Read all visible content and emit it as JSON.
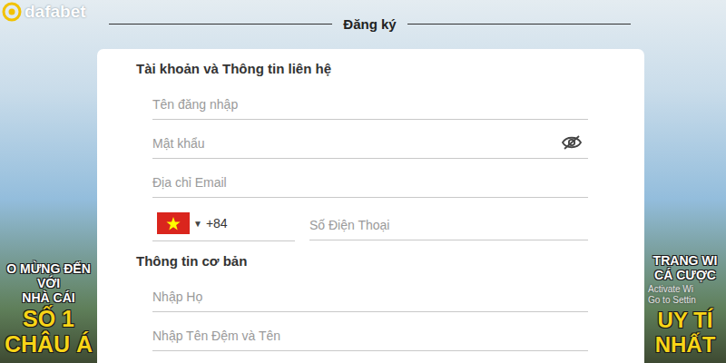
{
  "brand": {
    "name": "dafabet"
  },
  "header": {
    "title": "Đăng ký"
  },
  "form": {
    "sections": [
      {
        "title": "Tài khoản và Thông tin liên hệ",
        "fields": [
          {
            "kind": "text",
            "placeholder": "Tên đăng nhập"
          },
          {
            "kind": "password",
            "placeholder": "Mật khẩu"
          },
          {
            "kind": "text",
            "placeholder": "Địa chỉ Email"
          },
          {
            "kind": "phone",
            "country_code": "+84",
            "dropdown_icon": "▼",
            "placeholder": "Số Điện Thoại"
          }
        ]
      },
      {
        "title": "Thông tin cơ bản",
        "fields": [
          {
            "kind": "text",
            "placeholder": "Nhập Họ"
          },
          {
            "kind": "text",
            "placeholder": "Nhập Tên Đệm và Tên"
          }
        ]
      }
    ]
  },
  "promo_left": {
    "lines": [
      {
        "text": "O MỪNG ĐẾN",
        "kind": "small",
        "color": "#ffffff"
      },
      {
        "text": "VỚI",
        "kind": "small",
        "color": "#ffffff"
      },
      {
        "text": "NHÀ CÁI",
        "kind": "small",
        "color": "#ffffff"
      },
      {
        "text": "SỐ 1",
        "kind": "big",
        "color": "#f7d417"
      },
      {
        "text": "CHÂU Á",
        "kind": "big",
        "color": "#f7d417"
      }
    ]
  },
  "promo_right": {
    "lines": [
      {
        "text": "TRANG WI",
        "kind": "small",
        "color": "#ffffff"
      },
      {
        "text": "CÁ CƯỢC",
        "kind": "small",
        "color": "#ffffff"
      },
      {
        "text": "UY TÍ",
        "kind": "big",
        "color": "#f7d417"
      },
      {
        "text": "NHẤT",
        "kind": "big",
        "color": "#f7d417"
      }
    ]
  },
  "watermark": {
    "lines": [
      "Activate Wi",
      "Go to Settin"
    ]
  }
}
